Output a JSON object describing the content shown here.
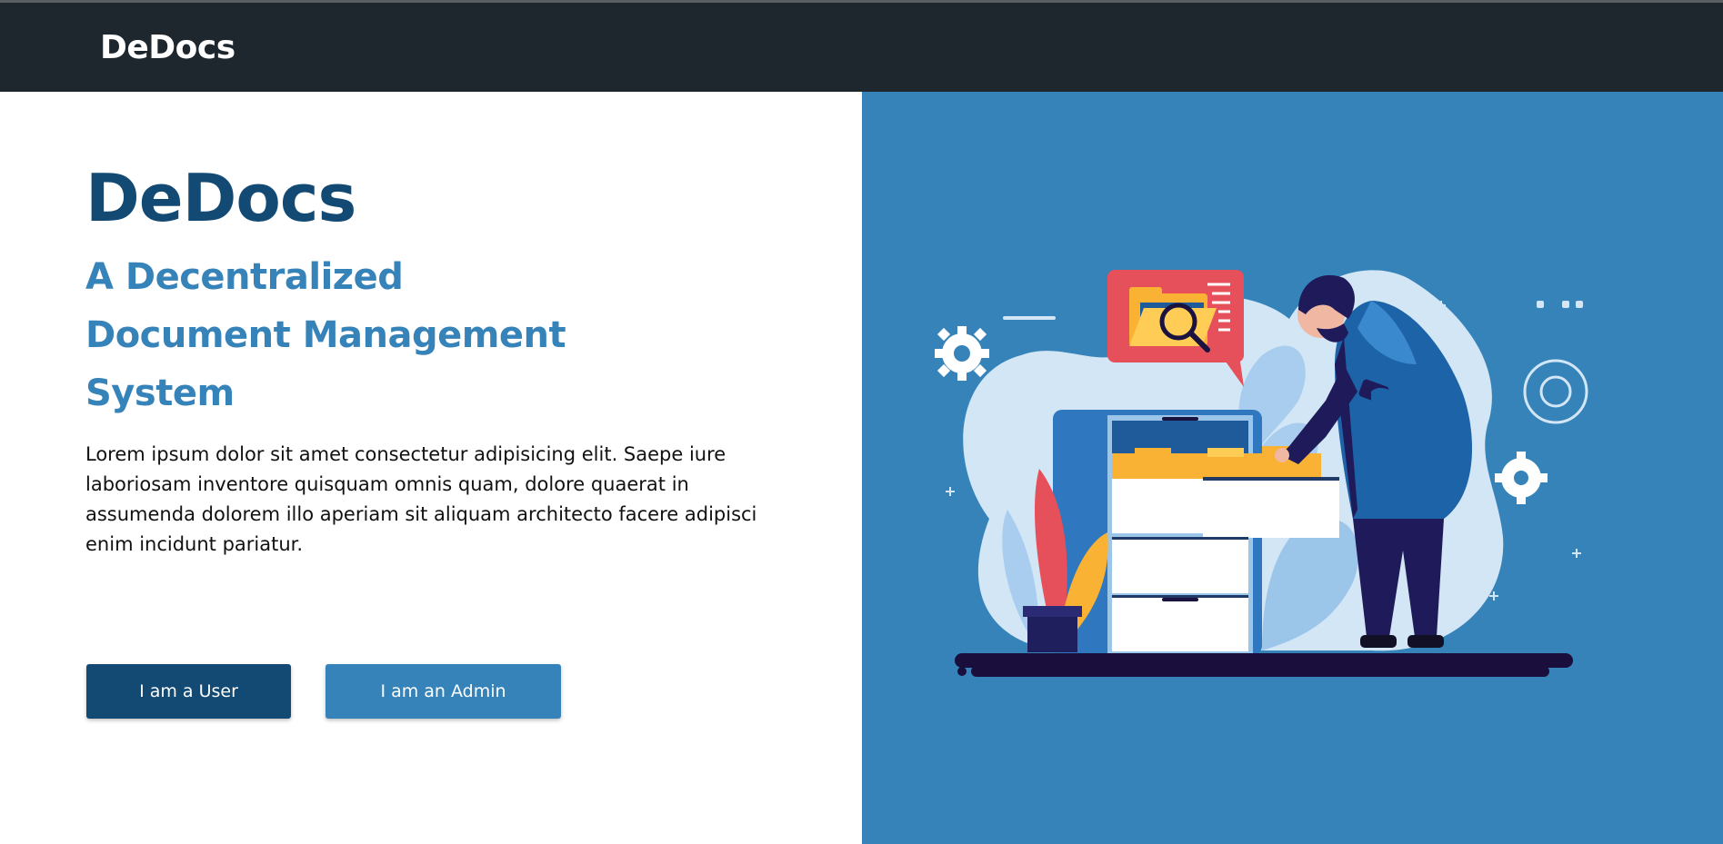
{
  "navbar": {
    "brand": "DeDocs"
  },
  "hero": {
    "title": "DeDocs",
    "subtitle_lines": [
      "A Decentralized",
      "Document Management",
      "System"
    ],
    "description": "Lorem ipsum dolor sit amet consectetur adipisicing elit. Saepe iure laboriosam inventore quisquam omnis quam, dolore quaerat in assumenda dolorem illo aperiam sit aliquam architecto facere adipisci enim incidunt pariatur.",
    "buttons": {
      "user_label": "I am a User",
      "admin_label": "I am an Admin"
    }
  },
  "colors": {
    "navbar_bg": "#1e272d",
    "primary_dark": "#134a74",
    "primary": "#3683ba",
    "illustration_bg": "#3683ba"
  },
  "illustration": {
    "icon": "document-search-illustration"
  }
}
